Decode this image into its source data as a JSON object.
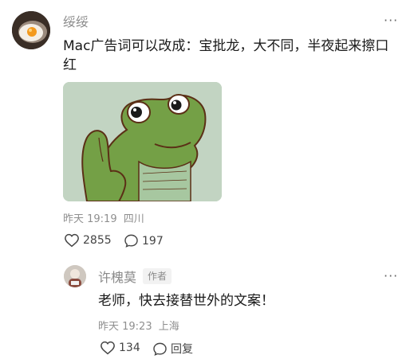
{
  "comment": {
    "username": "绥绥",
    "text": "Mac广告词可以改成：宝批龙，大不同，半夜起来擦口红",
    "time": "昨天 19:19",
    "location": "四川",
    "likes": "2855",
    "replies": "197",
    "more_label": "···"
  },
  "reply": {
    "username": "许槐莫",
    "badge": "作者",
    "text": "老师，快去接替世外的文案！",
    "time": "昨天 19:23",
    "location": "上海",
    "likes": "134",
    "reply_label": "回复",
    "more_label": "···"
  },
  "icons": {
    "like": "heart-outline-icon",
    "comment": "speech-bubble-icon",
    "more": "more-dots-icon"
  }
}
